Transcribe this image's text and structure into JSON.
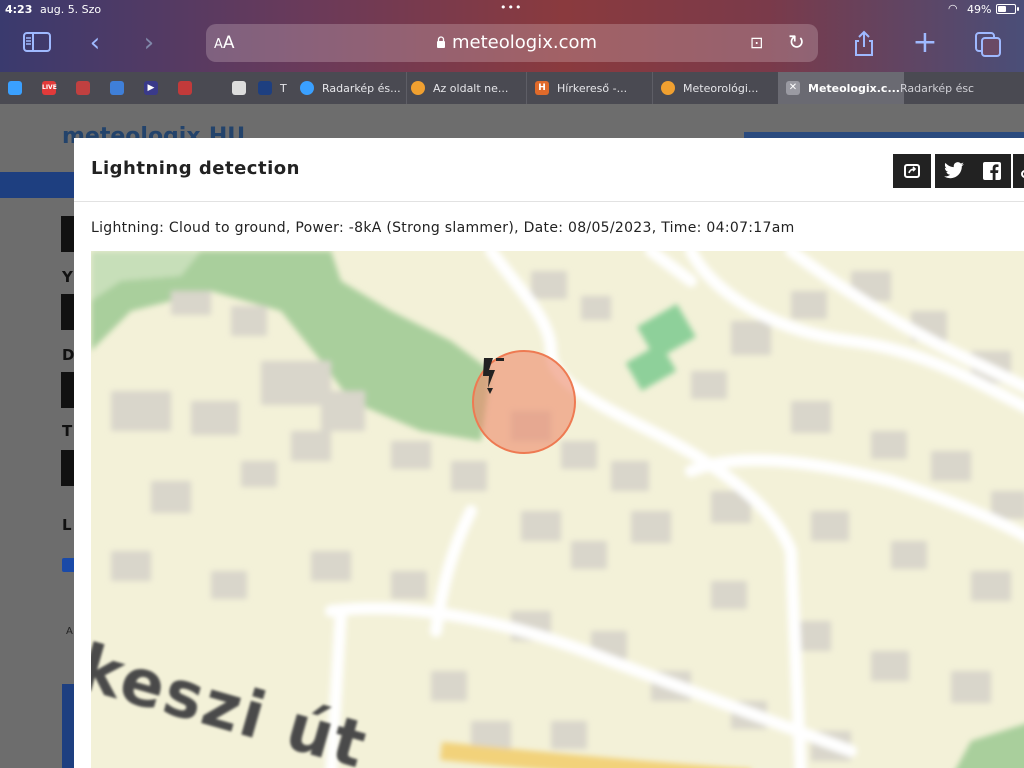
{
  "status_bar": {
    "time": "4:23",
    "date": "aug. 5. Szo",
    "battery": "49%"
  },
  "browser": {
    "text_size_label": "AA",
    "url": "meteologix.com"
  },
  "tabs": [
    {
      "label": "",
      "color": "#3aa0ff",
      "icon": "T"
    },
    {
      "label": "",
      "color": "#e23a3a",
      "icon": "LIVE"
    },
    {
      "label": "",
      "color": "#c04040",
      "icon": ""
    },
    {
      "label": "",
      "color": "#3f7fd8",
      "icon": ""
    },
    {
      "label": "",
      "color": "#3a3a8a",
      "icon": "▶"
    },
    {
      "label": "",
      "color": "#c23a3a",
      "icon": ""
    },
    {
      "label": "",
      "color": "#dddddd",
      "icon": ""
    },
    {
      "label": "T",
      "color": "#1e3f80",
      "icon": ""
    },
    {
      "label": "Radarkép és...",
      "color": "#3aa0ff",
      "icon": ""
    },
    {
      "label": "Az oldalt ne...",
      "color": "#f0a030",
      "icon": ""
    },
    {
      "label": "Hírkereső -...",
      "color": "#e06a2a",
      "icon": "H"
    },
    {
      "label": "Meteorológi...",
      "color": "#f0a030",
      "icon": ""
    },
    {
      "label": "Meteologix.c...",
      "color": "#9a9aa2",
      "icon": "✕",
      "active": true
    },
    {
      "label": "Radarkép és...",
      "color": "#3aa0ff",
      "icon": ""
    },
    {
      "label": "c",
      "color": "#4a4a52",
      "icon": ""
    }
  ],
  "background_page": {
    "logo": "meteologix.HU",
    "labels": [
      "Y",
      "D",
      "T",
      "L"
    ],
    "small_text": "A"
  },
  "modal": {
    "title": "Lightning detection",
    "info": "Lightning: Cloud to ground, Power: -8kA (Strong slammer), Date: 08/05/2023, Time: 04:07:17am"
  },
  "map": {
    "street_label": "keszi út",
    "strike_color": "#ee7a52"
  },
  "icons": {
    "sidebar": "sidebar-icon",
    "back": "chevron-left-icon",
    "forward": "chevron-right-icon",
    "share": "share-icon",
    "new_tab": "plus-icon",
    "tabs": "tabs-icon",
    "lightning": "lightning-bolt-icon"
  }
}
